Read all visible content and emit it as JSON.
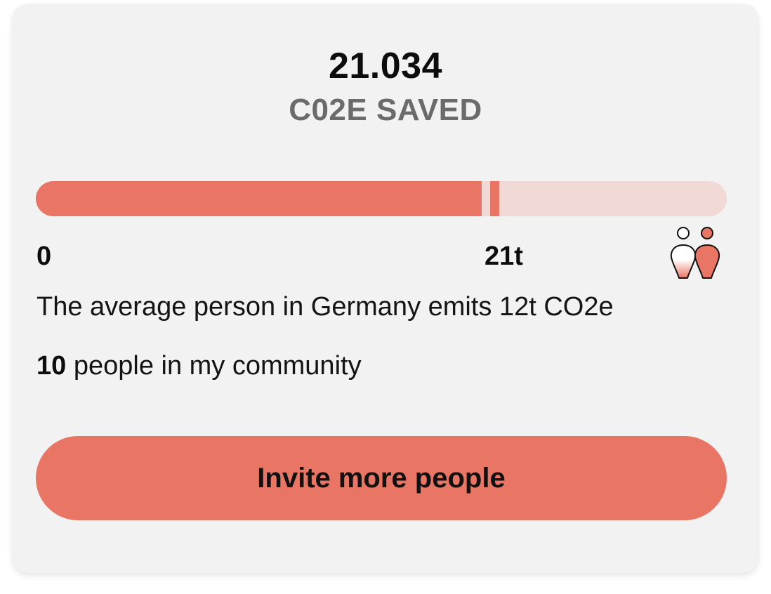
{
  "summary": {
    "value": "21.034",
    "label": "C02E SAVED"
  },
  "progress": {
    "fill_fraction": 0.645,
    "marker_fraction": 0.658,
    "scale_start_label": "0",
    "scale_marker_label": "21t",
    "accent_color": "#e97664",
    "track_color": "#f1d9d5"
  },
  "info": {
    "average_text": "The average person in Germany emits 12t CO2e",
    "community_count": "10",
    "community_suffix": " people in my community"
  },
  "actions": {
    "invite_label": "Invite more people"
  },
  "icons": {
    "people": "people-comparison-icon"
  }
}
